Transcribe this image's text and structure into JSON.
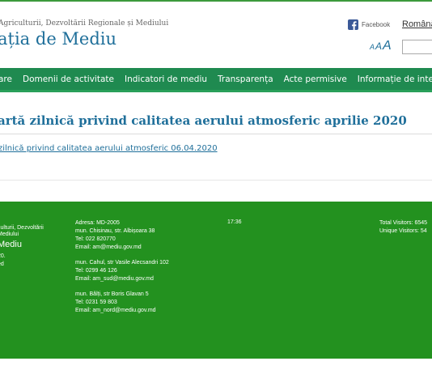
{
  "header": {
    "ministry": "Agriculturii, Dezvoltării Regionale și Mediului",
    "title": "ația de Mediu",
    "facebook_label": "Facebook",
    "language": "Română",
    "font_sizes": [
      "A",
      "A",
      "A"
    ]
  },
  "nav": {
    "items": [
      "are",
      "Domenii de activitate",
      "Indicatori de mediu",
      "Transparența",
      "Acte permisive",
      "Informație de interes public"
    ]
  },
  "main": {
    "heading": "artă zilnică privind calitatea aerului atmosferic aprilie 2020",
    "link": "zilnică privind calitatea aerului atmosferic 06.04.2020"
  },
  "footer": {
    "ministry": "culturii, Dezvoltării Mediului",
    "name": "Mediu",
    "year": "20.",
    "rights": "ed",
    "addresses": [
      {
        "lines": [
          "Adresa: MD-2005",
          "mun. Chisinau, str. Albișoara 38",
          "Tel: 022 820770",
          "Email: am@mediu.gov.md"
        ]
      },
      {
        "lines": [
          "mun. Cahul, str Vasile Alecsandri 102",
          "Tel: 0299 46 126",
          "Email: am_sud@mediu.gov.md"
        ]
      },
      {
        "lines": [
          "mun. Bălți, str Boris Glavan 5",
          "Tel: 0231 59 803",
          "Email: am_nord@mediu.gov.md"
        ]
      }
    ],
    "time": "17:36",
    "total_visitors": "Total Visitors: 6545",
    "unique_visitors": "Unique Visitors: 54"
  },
  "colors": {
    "nav_bg": "#1f8a50",
    "footer_bg": "#23911f",
    "title_blue": "#1f6f9a",
    "facebook_blue": "#3b5998"
  },
  "icons": {
    "facebook": "facebook-icon"
  }
}
